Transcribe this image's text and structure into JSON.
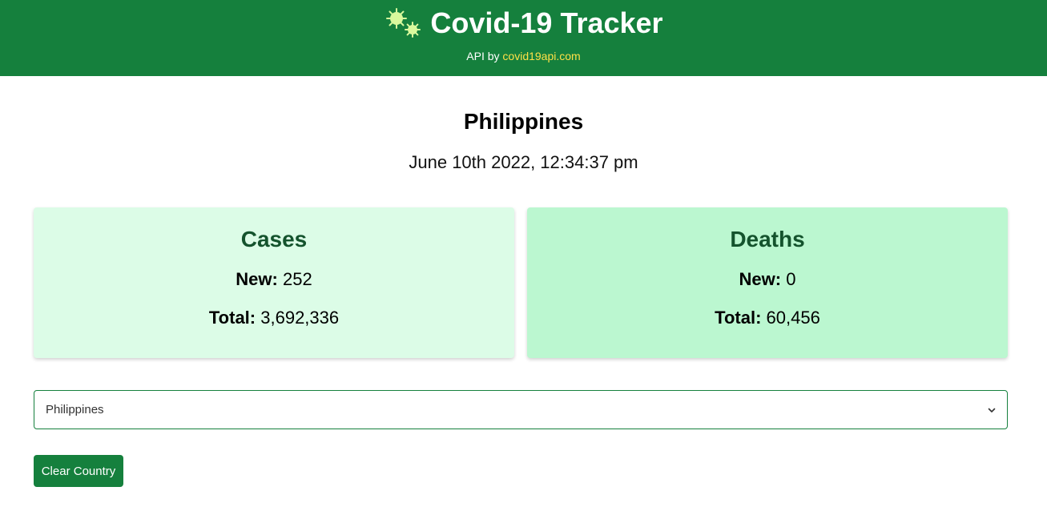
{
  "header": {
    "title": "Covid-19 Tracker",
    "icon": "virus-icon",
    "api_prefix": "API by",
    "api_link_text": "covid19api.com",
    "background_color": "#15803d",
    "link_color": "#fde047"
  },
  "summary": {
    "country": "Philippines",
    "timestamp": "June 10th 2022, 12:34:37 pm"
  },
  "cards": {
    "cases": {
      "heading": "Cases",
      "new_label": "New:",
      "new_value": "252",
      "total_label": "Total:",
      "total_value": "3,692,336",
      "background_color": "#dcfce7"
    },
    "deaths": {
      "heading": "Deaths",
      "new_label": "New:",
      "new_value": "0",
      "total_label": "Total:",
      "total_value": "60,456",
      "background_color": "#bbf7d0"
    }
  },
  "country_select": {
    "selected": "Philippines",
    "icon": "chevron-down-icon"
  },
  "clear_button": {
    "label": "Clear Country"
  }
}
